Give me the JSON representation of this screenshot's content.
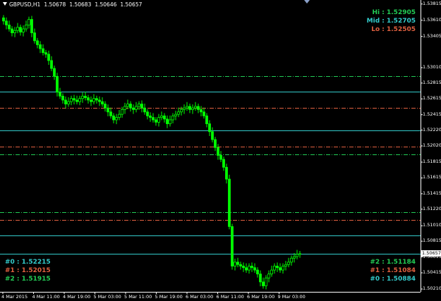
{
  "header": {
    "symbol": "GBPUSD,H1",
    "open": "1.50678",
    "high": "1.50683",
    "low": "1.50646",
    "close": "1.50657"
  },
  "colors": {
    "background": "#000000",
    "candle": "#00ff00",
    "axis": "#ffffff",
    "hi": "#22cc55",
    "mid": "#33cccc",
    "lo": "#e06040",
    "pivot0": "#33cccc",
    "pivot1": "#e06040",
    "pivot2": "#22cc55"
  },
  "levels_top_right": [
    {
      "label": "Hi : 1.52905",
      "color": "#22cc55"
    },
    {
      "label": "Mid : 1.52705",
      "color": "#33cccc"
    },
    {
      "label": "Lo : 1.52505",
      "color": "#e06040"
    }
  ],
  "levels_bottom_left": [
    {
      "label": "#0 : 1.52215",
      "color": "#33cccc"
    },
    {
      "label": "#1 : 1.52015",
      "color": "#e06040"
    },
    {
      "label": "#2 : 1.51915",
      "color": "#22cc55"
    }
  ],
  "levels_bottom_right": [
    {
      "label": "#2 : 1.51184",
      "color": "#22cc55"
    },
    {
      "label": "#1 : 1.51084",
      "color": "#e06040"
    },
    {
      "label": "#0 : 1.50884",
      "color": "#33cccc"
    }
  ],
  "chart_data": {
    "type": "candlestick",
    "symbol": "GBPUSD",
    "timeframe": "H1",
    "ylim": [
      1.5021,
      1.5383
    ],
    "y_ticks": [
      "1.53815",
      "1.53610",
      "1.53405",
      "1.53010",
      "1.52815",
      "1.52615",
      "1.52415",
      "1.52220",
      "1.52020",
      "1.51815",
      "1.51615",
      "1.51415",
      "1.51220",
      "1.51010",
      "1.50815",
      "1.50615",
      "1.50415",
      "1.50210"
    ],
    "x_ticks": [
      "4 Mar 2015",
      "4 Mar 11:00",
      "4 Mar 19:00",
      "5 Mar 03:00",
      "5 Mar 11:00",
      "5 Mar 19:00",
      "6 Mar 03:00",
      "6 Mar 11:00",
      "6 Mar 19:00",
      "9 Mar 03:00"
    ],
    "current_price": "1.50657",
    "horizontal_levels": [
      {
        "value": 1.52905,
        "style": "dashdot",
        "color": "#22cc55"
      },
      {
        "value": 1.52705,
        "style": "solid",
        "color": "#33cccc"
      },
      {
        "value": 1.52505,
        "style": "dashdot",
        "color": "#e06040"
      },
      {
        "value": 1.52215,
        "style": "solid",
        "color": "#33cccc"
      },
      {
        "value": 1.52015,
        "style": "dashdot",
        "color": "#e06040"
      },
      {
        "value": 1.51915,
        "style": "dashdot",
        "color": "#22cc55"
      },
      {
        "value": 1.51184,
        "style": "dashdot",
        "color": "#22cc55"
      },
      {
        "value": 1.51084,
        "style": "dashdot",
        "color": "#e06040"
      },
      {
        "value": 1.50884,
        "style": "solid",
        "color": "#33cccc"
      },
      {
        "value": 1.50657,
        "style": "solid",
        "color": "#33cccc"
      }
    ],
    "closes": [
      1.536,
      1.5355,
      1.535,
      1.5345,
      1.5348,
      1.5352,
      1.5346,
      1.535,
      1.5355,
      1.5362,
      1.5345,
      1.5335,
      1.533,
      1.5325,
      1.532,
      1.5318,
      1.531,
      1.53,
      1.529,
      1.527,
      1.5265,
      1.526,
      1.5255,
      1.5258,
      1.5262,
      1.526,
      1.5258,
      1.5262,
      1.5265,
      1.5263,
      1.526,
      1.5258,
      1.5262,
      1.526,
      1.5258,
      1.5255,
      1.525,
      1.5245,
      1.524,
      1.5235,
      1.5238,
      1.5242,
      1.5248,
      1.5252,
      1.5255,
      1.525,
      1.5248,
      1.5252,
      1.5255,
      1.525,
      1.5245,
      1.524,
      1.5238,
      1.5235,
      1.5232,
      1.5238,
      1.524,
      1.5236,
      1.523,
      1.5235,
      1.524,
      1.5242,
      1.5245,
      1.5248,
      1.525,
      1.5252,
      1.5248,
      1.525,
      1.5252,
      1.5248,
      1.5245,
      1.524,
      1.523,
      1.522,
      1.521,
      1.52,
      1.519,
      1.5185,
      1.5175,
      1.516,
      1.51,
      1.505,
      1.5055,
      1.5052,
      1.505,
      1.5048,
      1.5045,
      1.505,
      1.5048,
      1.5045,
      1.504,
      1.503,
      1.5025,
      1.5035,
      1.504,
      1.5045,
      1.505,
      1.5048,
      1.5045,
      1.505,
      1.5052,
      1.5055,
      1.506,
      1.5062,
      1.5065,
      1.50657
    ]
  }
}
